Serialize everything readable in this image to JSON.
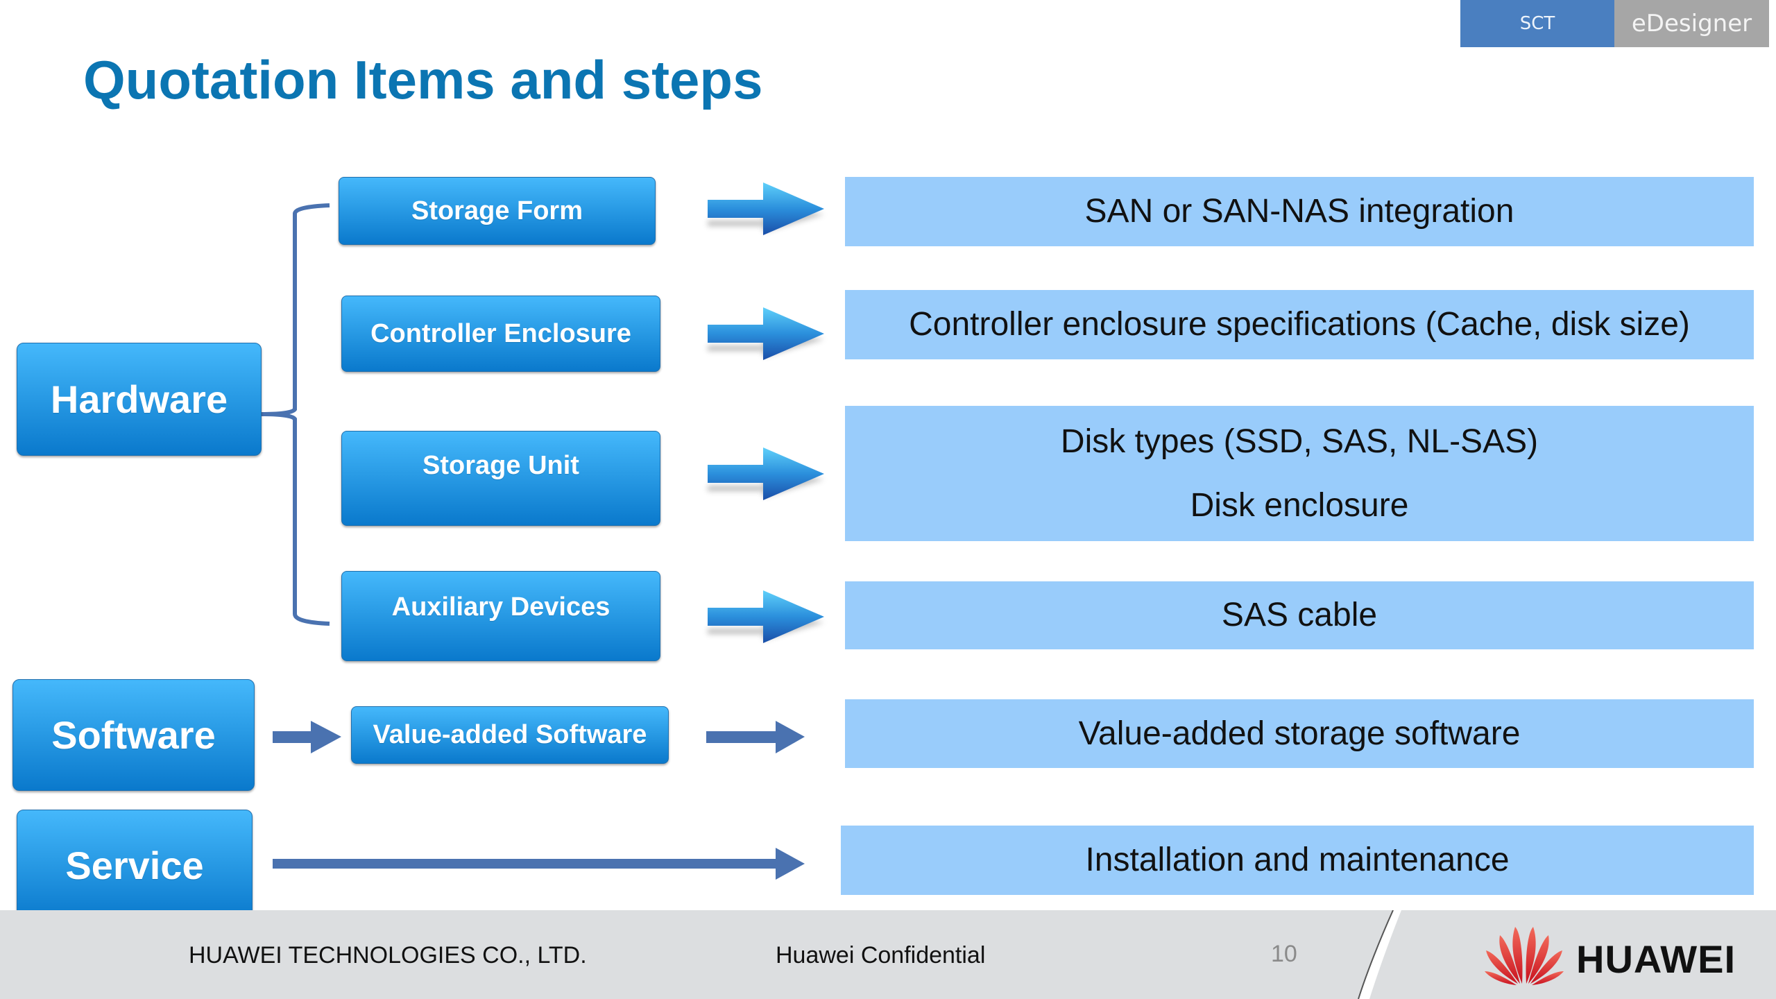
{
  "header": {
    "tabs": [
      {
        "label": "SCT"
      },
      {
        "label": "eDesigner"
      }
    ],
    "title": "Quotation Items and steps"
  },
  "diagram": {
    "categories": [
      {
        "label": "Hardware"
      },
      {
        "label": "Software"
      },
      {
        "label": "Service"
      }
    ],
    "hardware_items": [
      {
        "label": "Storage Form",
        "description": [
          "SAN or SAN-NAS integration"
        ]
      },
      {
        "label": "Controller Enclosure",
        "description": [
          "Controller enclosure specifications (Cache, disk size)"
        ]
      },
      {
        "label": "Storage Unit",
        "description": [
          "Disk types (SSD, SAS, NL-SAS)",
          "Disk enclosure"
        ]
      },
      {
        "label": "Auxiliary Devices",
        "description": [
          "SAS cable"
        ]
      }
    ],
    "software_items": [
      {
        "label": "Value-added Software",
        "description": [
          "Value-added storage software"
        ]
      }
    ],
    "service_items": [
      {
        "description": [
          "Installation and maintenance"
        ]
      }
    ],
    "colors": {
      "title": "#0b75b2",
      "button_top": "#45b8fb",
      "button_bottom": "#0a79cc",
      "panel": "#99ccfb",
      "connector": "#4a72b0"
    }
  },
  "footer": {
    "company": "HUAWEI TECHNOLOGIES CO., LTD.",
    "confidential": "Huawei Confidential",
    "page_number": "10",
    "logo_text": "HUAWEI"
  }
}
